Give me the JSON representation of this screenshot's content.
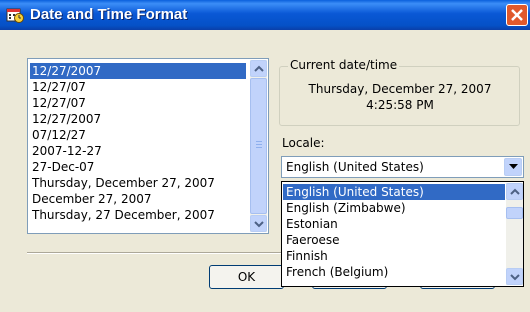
{
  "window": {
    "title": "Date and Time Format",
    "icons": {
      "app": "calendar-clock-icon",
      "close": "close-icon"
    }
  },
  "formats": {
    "items": [
      "12/27/2007",
      "12/27/07",
      "12/27/07",
      "12/27/2007",
      "07/12/27",
      "2007-12-27",
      "27-Dec-07",
      "Thursday, December 27, 2007",
      "December 27, 2007",
      "Thursday, 27 December, 2007"
    ],
    "selected": "12/27/2007"
  },
  "current": {
    "label": "Current date/time",
    "date": "Thursday, December 27, 2007",
    "time": "4:25:58 PM"
  },
  "locale": {
    "label": "Locale:",
    "value": "English (United States)",
    "options": [
      "English (United States)",
      "English (Zimbabwe)",
      "Estonian",
      "Faeroese",
      "Finnish",
      "French (Belgium)"
    ]
  },
  "buttons": {
    "ok": "OK"
  },
  "colors": {
    "selection": "#316ac5",
    "titlebar": "#0a58d6",
    "close": "#e0592c"
  }
}
